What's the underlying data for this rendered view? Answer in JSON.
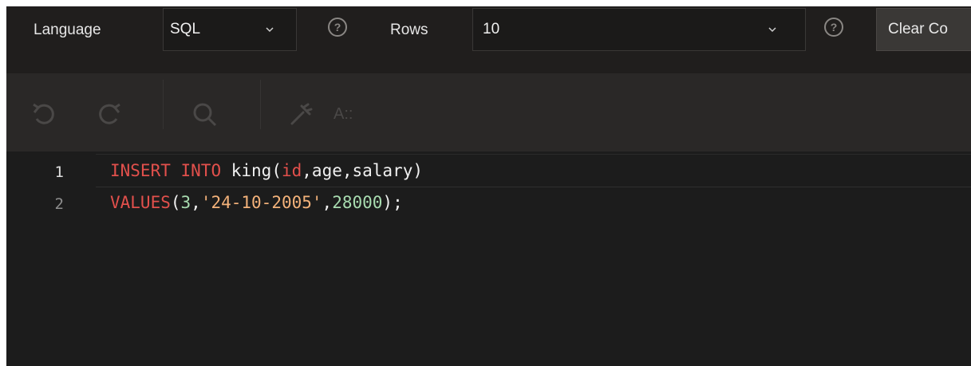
{
  "options": {
    "language_label": "Language",
    "language_value": "SQL",
    "rows_label": "Rows",
    "rows_value": "10",
    "help_glyph": "?",
    "clear_label": "Clear Co"
  },
  "toolbar": {
    "icons": [
      "undo-icon",
      "redo-icon",
      "search-icon",
      "wrench-icon",
      "font-size-icon"
    ],
    "font_size_glyph": "A::"
  },
  "editor": {
    "line_numbers": [
      "1",
      "2"
    ],
    "line1": {
      "kw_insert": "INSERT",
      "kw_into": "INTO",
      "table": "king",
      "open": "(",
      "col_id": "id",
      "rest": ",age,salary)"
    },
    "line2": {
      "kw_values": "VALUES",
      "open": "(",
      "num1": "3",
      "comma1": ",",
      "str1": "'24-10-2005'",
      "comma2": ",",
      "num2": "28000",
      "close": ");"
    }
  },
  "colors": {
    "keyword": "#e2504c",
    "string": "#f3b27a",
    "number": "#a8dcb0",
    "background": "#1c1c1c",
    "toolbar": "#2a2827"
  }
}
